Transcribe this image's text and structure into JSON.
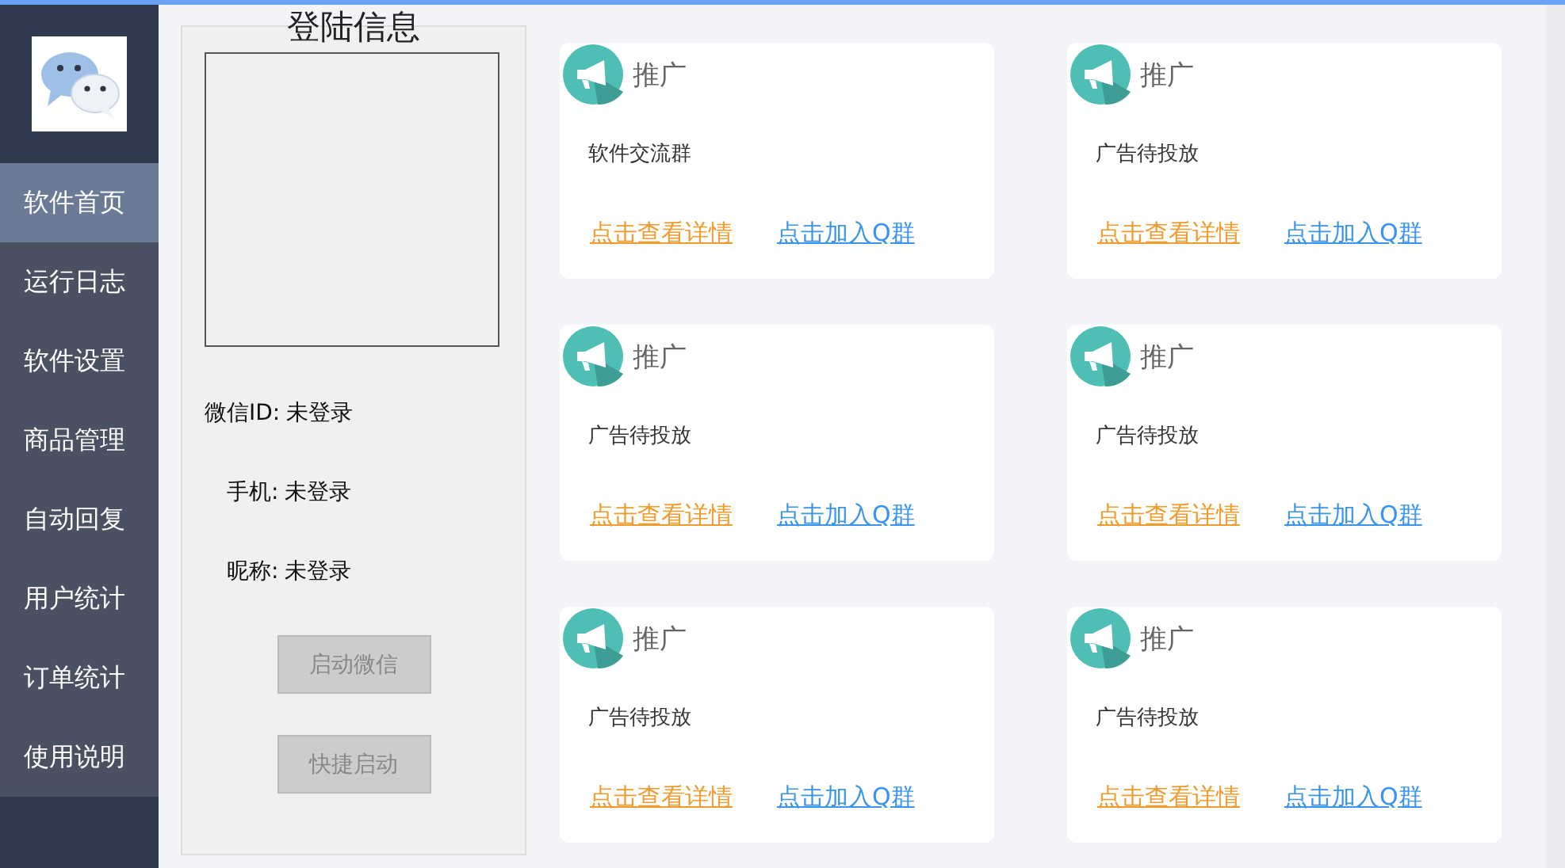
{
  "sidebar": {
    "items": [
      {
        "label": "软件首页",
        "selected": true
      },
      {
        "label": "运行日志",
        "selected": false
      },
      {
        "label": "软件设置",
        "selected": false
      },
      {
        "label": "商品管理",
        "selected": false
      },
      {
        "label": "自动回复",
        "selected": false
      },
      {
        "label": "用户统计",
        "selected": false
      },
      {
        "label": "订单统计",
        "selected": false
      },
      {
        "label": "使用说明",
        "selected": false
      }
    ]
  },
  "login_panel": {
    "title": "登陆信息",
    "fields": [
      {
        "label": "微信ID:",
        "value": "未登录"
      },
      {
        "label": "手机:",
        "value": "未登录"
      },
      {
        "label": "昵称:",
        "value": "未登录"
      }
    ],
    "buttons": [
      {
        "label": "启动微信",
        "disabled": true
      },
      {
        "label": "快捷启动",
        "disabled": true
      }
    ]
  },
  "cards": [
    {
      "title": "推广",
      "text": "软件交流群",
      "detail_link": "点击查看详情",
      "join_link": "点击加入Q群"
    },
    {
      "title": "推广",
      "text": "广告待投放",
      "detail_link": "点击查看详情",
      "join_link": "点击加入Q群"
    },
    {
      "title": "推广",
      "text": "广告待投放",
      "detail_link": "点击查看详情",
      "join_link": "点击加入Q群"
    },
    {
      "title": "推广",
      "text": "广告待投放",
      "detail_link": "点击查看详情",
      "join_link": "点击加入Q群"
    },
    {
      "title": "推广",
      "text": "广告待投放",
      "detail_link": "点击查看详情",
      "join_link": "点击加入Q群"
    },
    {
      "title": "推广",
      "text": "广告待投放",
      "detail_link": "点击查看详情",
      "join_link": "点击加入Q群"
    }
  ]
}
